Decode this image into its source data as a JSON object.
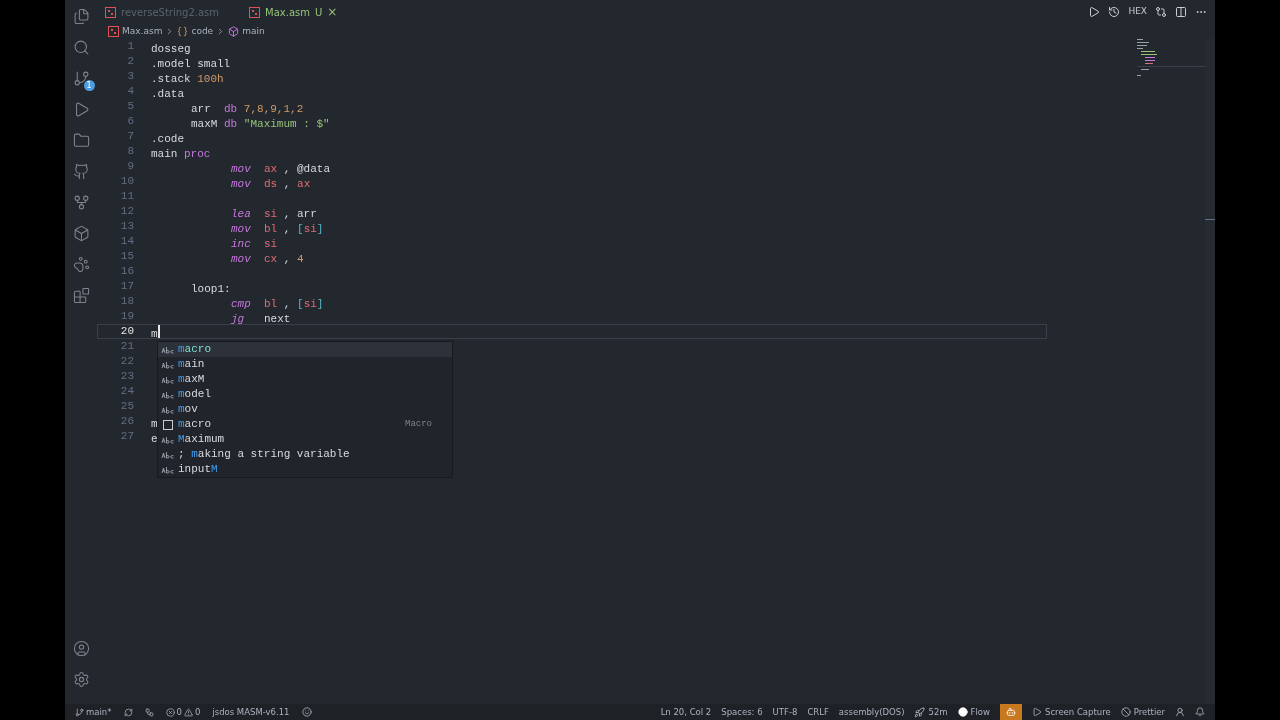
{
  "tabs": [
    {
      "label": "reverseString2.asm",
      "selected": false
    },
    {
      "label": "Max.asm",
      "selected": true,
      "status": "U",
      "close": "×"
    }
  ],
  "breadcrumbs": [
    {
      "kind": "file",
      "text": "Max.asm"
    },
    {
      "kind": "section",
      "text": "code"
    },
    {
      "kind": "symbol",
      "text": "main"
    }
  ],
  "toolbar": {
    "hex": "HEX"
  },
  "source_control_badge": "1",
  "editor": {
    "lines": [
      {
        "number": "1",
        "kind": "directive",
        "current": false,
        "tokens": [
          {
            "text": "dosseg",
            "kind": "plain"
          }
        ]
      },
      {
        "number": "2",
        "kind": "directive",
        "current": false,
        "tokens": [
          {
            "text": ".model small",
            "kind": "plain"
          }
        ]
      },
      {
        "number": "3",
        "kind": "directive",
        "current": false,
        "tokens": [
          {
            "text": ".stack ",
            "kind": "plain"
          },
          {
            "text": "100h",
            "kind": "number"
          }
        ]
      },
      {
        "number": "4",
        "kind": "directive",
        "current": false,
        "tokens": [
          {
            "text": ".data",
            "kind": "plain"
          }
        ]
      },
      {
        "number": "5",
        "kind": "data",
        "current": false,
        "tokens": [
          {
            "text": "arr  ",
            "kind": "plain"
          },
          {
            "text": "db ",
            "kind": "keyword"
          },
          {
            "text": "7,8,9,1,2",
            "kind": "number"
          }
        ]
      },
      {
        "number": "6",
        "kind": "data",
        "current": false,
        "tokens": [
          {
            "text": "maxM ",
            "kind": "plain"
          },
          {
            "text": "db ",
            "kind": "keyword"
          },
          {
            "text": "\"Maximum : $\"",
            "kind": "string"
          }
        ]
      },
      {
        "number": "7",
        "kind": "directive",
        "current": false,
        "tokens": [
          {
            "text": ".code",
            "kind": "plain"
          }
        ]
      },
      {
        "number": "8",
        "kind": "directive",
        "current": false,
        "tokens": [
          {
            "text": "main ",
            "kind": "plain"
          },
          {
            "text": "proc",
            "kind": "keyword"
          }
        ]
      },
      {
        "number": "9",
        "kind": "instruction",
        "current": false,
        "tokens": [
          {
            "text": "mov  ",
            "kind": "instruction"
          },
          {
            "text": "ax",
            "kind": "register"
          },
          {
            "text": " , @data",
            "kind": "plain"
          }
        ]
      },
      {
        "number": "10",
        "kind": "instruction",
        "current": false,
        "tokens": [
          {
            "text": "mov  ",
            "kind": "instruction"
          },
          {
            "text": "ds",
            "kind": "register"
          },
          {
            "text": " , ",
            "kind": "plain"
          },
          {
            "text": "ax",
            "kind": "register"
          }
        ]
      },
      {
        "number": "11",
        "current": false
      },
      {
        "number": "12",
        "kind": "instruction",
        "current": false,
        "tokens": [
          {
            "text": "lea  ",
            "kind": "instruction"
          },
          {
            "text": "si",
            "kind": "register"
          },
          {
            "text": " , arr",
            "kind": "plain"
          }
        ]
      },
      {
        "number": "13",
        "kind": "instruction",
        "current": false,
        "tokens": [
          {
            "text": "mov  ",
            "kind": "instruction"
          },
          {
            "text": "bl",
            "kind": "register"
          },
          {
            "text": " , ",
            "kind": "plain"
          },
          {
            "text": "[",
            "kind": "bracket"
          },
          {
            "text": "si",
            "kind": "register"
          },
          {
            "text": "]",
            "kind": "bracket"
          }
        ]
      },
      {
        "number": "14",
        "kind": "instruction",
        "current": false,
        "tokens": [
          {
            "text": "inc  ",
            "kind": "instruction"
          },
          {
            "text": "si",
            "kind": "register"
          }
        ]
      },
      {
        "number": "15",
        "kind": "instruction",
        "current": false,
        "tokens": [
          {
            "text": "mov  ",
            "kind": "instruction"
          },
          {
            "text": "cx",
            "kind": "register"
          },
          {
            "text": " , ",
            "kind": "plain"
          },
          {
            "text": "4",
            "kind": "number"
          }
        ]
      },
      {
        "number": "16",
        "current": false
      },
      {
        "number": "17",
        "kind": "label",
        "current": false,
        "tokens": [
          {
            "text": "loop1:",
            "kind": "plain"
          }
        ]
      },
      {
        "number": "18",
        "kind": "instruction",
        "current": false,
        "tokens": [
          {
            "text": "cmp  ",
            "kind": "instruction"
          },
          {
            "text": "bl",
            "kind": "register"
          },
          {
            "text": " , ",
            "kind": "plain"
          },
          {
            "text": "[",
            "kind": "bracket"
          },
          {
            "text": "si",
            "kind": "register"
          },
          {
            "text": "]",
            "kind": "bracket"
          }
        ]
      },
      {
        "number": "19",
        "kind": "instruction",
        "current": false,
        "tokens": [
          {
            "text": "jg",
            "kind": "instruction"
          },
          {
            "text": "   next",
            "kind": "plain"
          }
        ]
      },
      {
        "number": "20",
        "kind": "directive",
        "current": true,
        "tokens": [
          {
            "text": "m",
            "kind": "plain"
          }
        ]
      },
      {
        "number": "21",
        "current": false
      },
      {
        "number": "22",
        "current": false
      },
      {
        "number": "23",
        "current": false
      },
      {
        "number": "24",
        "current": false
      },
      {
        "number": "25",
        "current": false
      },
      {
        "number": "26",
        "kind": "directive",
        "current": false,
        "tokens": [
          {
            "text": "m",
            "kind": "plain"
          }
        ]
      },
      {
        "number": "27",
        "kind": "directive",
        "current": false,
        "tokens": [
          {
            "text": "e",
            "kind": "plain"
          }
        ]
      }
    ]
  },
  "suggestions": [
    {
      "kind": "text",
      "selected": true,
      "parts": [
        {
          "text": "m",
          "match": true
        },
        {
          "text": "acro",
          "match": false
        }
      ]
    },
    {
      "kind": "text",
      "selected": false,
      "parts": [
        {
          "text": "m",
          "match": true
        },
        {
          "text": "ain",
          "match": false
        }
      ]
    },
    {
      "kind": "text",
      "selected": false,
      "parts": [
        {
          "text": "m",
          "match": true
        },
        {
          "text": "axM",
          "match": false
        }
      ]
    },
    {
      "kind": "text",
      "selected": false,
      "parts": [
        {
          "text": "m",
          "match": true
        },
        {
          "text": "odel",
          "match": false
        }
      ]
    },
    {
      "kind": "text",
      "selected": false,
      "parts": [
        {
          "text": "m",
          "match": true
        },
        {
          "text": "ov",
          "match": false
        }
      ]
    },
    {
      "kind": "snippet",
      "selected": false,
      "parts": [
        {
          "text": "m",
          "match": true
        },
        {
          "text": "acro",
          "match": false
        }
      ],
      "detail": "Macro"
    },
    {
      "kind": "text",
      "selected": false,
      "parts": [
        {
          "text": "M",
          "match": true
        },
        {
          "text": "aximum",
          "match": false
        }
      ]
    },
    {
      "kind": "text",
      "selected": false,
      "parts": [
        {
          "text": "; ",
          "match": false
        },
        {
          "text": "m",
          "match": true
        },
        {
          "text": "aking a string variable",
          "match": false
        }
      ]
    },
    {
      "kind": "text",
      "selected": false,
      "parts": [
        {
          "text": "input",
          "match": false
        },
        {
          "text": "M",
          "match": true
        }
      ]
    }
  ],
  "status_bar": {
    "branch": "main*",
    "errors": "0",
    "warnings": "0",
    "assembler": "jsdos MASM-v6.11",
    "right": [
      {
        "kind": "text",
        "text": "Ln 20, Col 2"
      },
      {
        "kind": "text",
        "text": "Spaces: 6"
      },
      {
        "kind": "text",
        "text": "UTF-8"
      },
      {
        "kind": "text",
        "text": "CRLF"
      },
      {
        "kind": "text",
        "text": "assembly(DOS)"
      },
      {
        "kind": "rocket",
        "text": "52m"
      },
      {
        "kind": "dot",
        "text": "Flow"
      },
      {
        "kind": "copilot"
      },
      {
        "kind": "play",
        "text": "Screen Capture"
      },
      {
        "kind": "blocked",
        "text": "Prettier"
      },
      {
        "kind": "person"
      },
      {
        "kind": "bell"
      }
    ]
  }
}
